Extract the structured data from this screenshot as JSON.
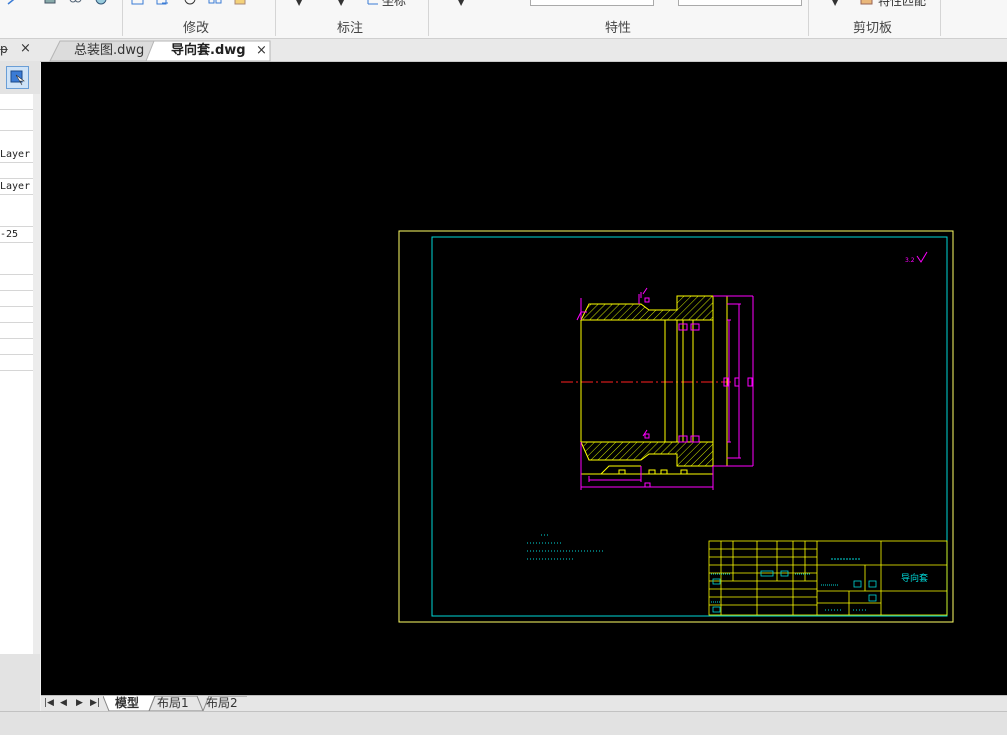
{
  "ribbon": {
    "groups": [
      {
        "id": "modify",
        "label": "修改"
      },
      {
        "id": "annotate",
        "label": "标注"
      },
      {
        "id": "properties",
        "label": "特性"
      },
      {
        "id": "clipboard",
        "label": "剪切板"
      }
    ],
    "coord_label": "坐标",
    "match_prop_label": "特性匹配"
  },
  "doc_tabs": [
    {
      "label": "总装图.dwg",
      "active": false
    },
    {
      "label": "导向套.dwg",
      "active": true
    }
  ],
  "tab_close": "×",
  "left_panel": {
    "header_pin": "ᵽ",
    "header_close": "×",
    "rows": [
      "",
      "",
      "Layer",
      "",
      "Layer",
      "",
      "-25",
      "",
      "",
      "",
      "",
      "",
      "",
      ""
    ]
  },
  "layout_tabs": {
    "nav": [
      "|◀",
      "◀",
      "▶",
      "▶|"
    ],
    "tabs": [
      {
        "label": "模型",
        "active": true
      },
      {
        "label": "布局1",
        "active": false
      },
      {
        "label": "布局2",
        "active": false
      }
    ]
  },
  "drawing": {
    "title_block": {
      "part_name": "导向套"
    }
  },
  "colors": {
    "canvas": "#000000",
    "frame": "#ffff66",
    "border": "#00d8d8",
    "part": "#ffff00",
    "dimension": "#ff00ff",
    "centerline": "#ff2020"
  }
}
